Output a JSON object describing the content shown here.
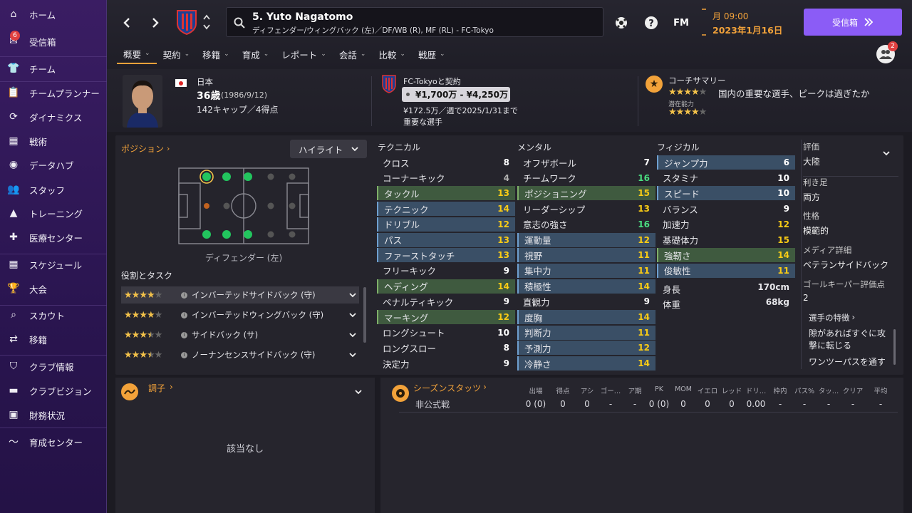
{
  "sidebar": {
    "inbox_badge": "6",
    "items": [
      {
        "label": "ホーム",
        "icon": "home-icon"
      },
      {
        "label": "受信箱",
        "icon": "inbox-icon"
      },
      {
        "label": "チーム",
        "icon": "team-icon"
      },
      {
        "label": "チームプランナー",
        "icon": "clipboard-icon"
      },
      {
        "label": "ダイナミクス",
        "icon": "dynamics-icon"
      },
      {
        "label": "戦術",
        "icon": "tactics-icon"
      },
      {
        "label": "データハブ",
        "icon": "data-hub-icon"
      },
      {
        "label": "スタッフ",
        "icon": "staff-icon"
      },
      {
        "label": "トレーニング",
        "icon": "training-icon"
      },
      {
        "label": "医療センター",
        "icon": "medical-icon"
      },
      {
        "label": "スケジュール",
        "icon": "calendar-icon"
      },
      {
        "label": "大会",
        "icon": "trophy-icon"
      },
      {
        "label": "スカウト",
        "icon": "search-icon"
      },
      {
        "label": "移籍",
        "icon": "transfer-icon"
      },
      {
        "label": "クラブ情報",
        "icon": "shield-icon"
      },
      {
        "label": "クラブビジョン",
        "icon": "briefcase-icon"
      },
      {
        "label": "財務状況",
        "icon": "money-icon"
      },
      {
        "label": "育成センター",
        "icon": "development-icon"
      }
    ]
  },
  "header": {
    "player_name": "5. Yuto Nagatomo",
    "player_sub": "ディフェンダー/ウィングバック (左)／DF/WB (R), MF (RL) - FC-Tokyo",
    "fm_label": "FM",
    "time": "月 09:00",
    "date": "2023年1月16日",
    "inbox_button": "受信箱",
    "notif_badge": "2",
    "tabs": [
      "概要",
      "契約",
      "移籍",
      "育成",
      "レポート",
      "会話",
      "比較",
      "戦歴"
    ]
  },
  "info": {
    "nationality": "日本",
    "age": "36歳",
    "birth": "(1986/9/12)",
    "caps": "142キャップ／4得点",
    "contract_title": "FC-Tokyoと契約",
    "value_range": "¥1,700万 - ¥4,250万",
    "wage": "¥172.5万／週で2025/1/31まで",
    "status": "重要な選手",
    "coach_title": "コーチサマリー",
    "coach_text": "国内の重要な選手、ピークは過ぎたか",
    "potential_label": "潜在能力",
    "current_stars": 4,
    "potential_stars": 4
  },
  "position": {
    "title": "ポジション",
    "dropdown": "ハイライト",
    "caption": "ディフェンダー (左)",
    "roles_title": "役割とタスク",
    "roles": [
      {
        "name": "インバーテッドサイドバック (守)",
        "stars": 4
      },
      {
        "name": "インバーテッドウィングバック (守)",
        "stars": 4
      },
      {
        "name": "サイドバック (サ)",
        "stars": 3.5
      },
      {
        "name": "ノーナンセンスサイドバック (守)",
        "stars": 3.5
      }
    ]
  },
  "attributes": {
    "technical_title": "テクニカル",
    "mental_title": "メンタル",
    "physical_title": "フィジカル",
    "technical": [
      {
        "name": "クロス",
        "value": "8",
        "hl": ""
      },
      {
        "name": "コーナーキック",
        "value": "4",
        "hl": ""
      },
      {
        "name": "タックル",
        "value": "13",
        "hl": "green"
      },
      {
        "name": "テクニック",
        "value": "14",
        "hl": "blue"
      },
      {
        "name": "ドリブル",
        "value": "12",
        "hl": "blue"
      },
      {
        "name": "パス",
        "value": "13",
        "hl": "blue"
      },
      {
        "name": "ファーストタッチ",
        "value": "13",
        "hl": "blue"
      },
      {
        "name": "フリーキック",
        "value": "9",
        "hl": ""
      },
      {
        "name": "ヘディング",
        "value": "14",
        "hl": "green"
      },
      {
        "name": "ペナルティキック",
        "value": "9",
        "hl": ""
      },
      {
        "name": "マーキング",
        "value": "12",
        "hl": "green"
      },
      {
        "name": "ロングシュート",
        "value": "10",
        "hl": ""
      },
      {
        "name": "ロングスロー",
        "value": "8",
        "hl": ""
      },
      {
        "name": "決定力",
        "value": "9",
        "hl": ""
      }
    ],
    "mental": [
      {
        "name": "オフザボール",
        "value": "7",
        "hl": ""
      },
      {
        "name": "チームワーク",
        "value": "16",
        "hl": ""
      },
      {
        "name": "ポジショニング",
        "value": "15",
        "hl": "green"
      },
      {
        "name": "リーダーシップ",
        "value": "13",
        "hl": ""
      },
      {
        "name": "意志の強さ",
        "value": "16",
        "hl": ""
      },
      {
        "name": "運動量",
        "value": "12",
        "hl": "blue"
      },
      {
        "name": "視野",
        "value": "11",
        "hl": "blue"
      },
      {
        "name": "集中力",
        "value": "11",
        "hl": "blue"
      },
      {
        "name": "積極性",
        "value": "14",
        "hl": "blue"
      },
      {
        "name": "直観力",
        "value": "9",
        "hl": ""
      },
      {
        "name": "度胸",
        "value": "14",
        "hl": "blue"
      },
      {
        "name": "判断力",
        "value": "11",
        "hl": "blue"
      },
      {
        "name": "予測力",
        "value": "12",
        "hl": "blue"
      },
      {
        "name": "冷静さ",
        "value": "14",
        "hl": "blue"
      }
    ],
    "physical": [
      {
        "name": "ジャンプ力",
        "value": "6",
        "hl": "blue"
      },
      {
        "name": "スタミナ",
        "value": "10",
        "hl": ""
      },
      {
        "name": "スピード",
        "value": "10",
        "hl": "blue"
      },
      {
        "name": "バランス",
        "value": "9",
        "hl": ""
      },
      {
        "name": "加速力",
        "value": "12",
        "hl": ""
      },
      {
        "name": "基礎体力",
        "value": "15",
        "hl": ""
      },
      {
        "name": "強靭さ",
        "value": "14",
        "hl": "green"
      },
      {
        "name": "俊敏性",
        "value": "11",
        "hl": "blue"
      }
    ],
    "height_label": "身長",
    "height": "170cm",
    "weight_label": "体重",
    "weight": "68kg"
  },
  "details": {
    "rating_label": "評価",
    "rating": "大陸",
    "foot_label": "利き足",
    "foot": "両方",
    "personality_label": "性格",
    "personality": "模範的",
    "media_label": "メディア詳細",
    "media": "ベテランサイドバック",
    "gk_label": "ゴールキーパー評価点",
    "gk": "2",
    "traits_title": "選手の特徴",
    "traits": [
      "隙があればすぐに攻撃に転じる",
      "ワンツーパスを通す"
    ]
  },
  "form": {
    "title": "調子",
    "empty": "該当なし"
  },
  "season": {
    "title": "シーズンスタッツ",
    "headers": [
      "出場",
      "得点",
      "アシ",
      "ゴー…",
      "ア期",
      "PK",
      "MOM",
      "イエロ",
      "レッド",
      "ドリ…",
      "枠内",
      "パス%",
      "タッ…",
      "クリア",
      "平均"
    ],
    "row_label": "非公式戦",
    "row": [
      "0 (0)",
      "0",
      "0",
      "-",
      "-",
      "0 (0)",
      "0",
      "0",
      "0",
      "0.00",
      "-",
      "-",
      "-",
      "-",
      "-"
    ]
  },
  "colors": {
    "accent": "#f2a23a",
    "inbox": "#8b5cf6",
    "sidebar": "#2a1550"
  }
}
